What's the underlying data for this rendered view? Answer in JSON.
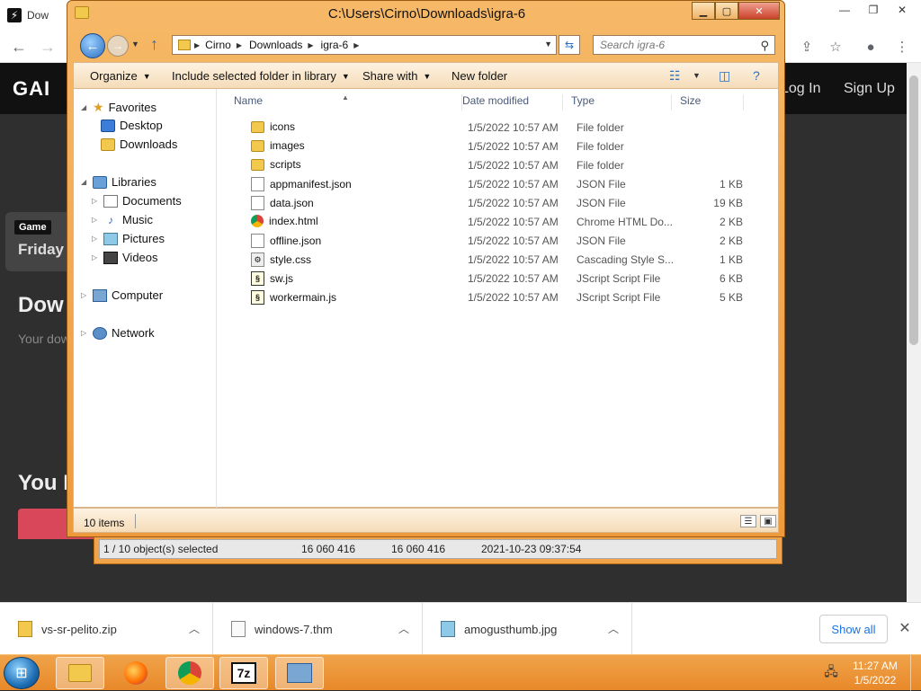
{
  "browser": {
    "tab_title": "Dow",
    "site": {
      "logo": "GAI",
      "login": "Log In",
      "signup": "Sign Up",
      "game_badge": "Game",
      "game_title": "Friday",
      "downloads_heading": "Dow",
      "downloads_sub": "Your dow",
      "you_heading": "You Ma"
    }
  },
  "explorer": {
    "title": "C:\\Users\\Cirno\\Downloads\\igra-6",
    "breadcrumbs": [
      "Cirno",
      "Downloads",
      "igra-6"
    ],
    "search_placeholder": "Search igra-6",
    "commands": {
      "organize": "Organize",
      "include": "Include selected folder in library",
      "share": "Share with",
      "new_folder": "New folder"
    },
    "nav": {
      "favorites": "Favorites",
      "desktop": "Desktop",
      "downloads": "Downloads",
      "libraries": "Libraries",
      "documents": "Documents",
      "music": "Music",
      "pictures": "Pictures",
      "videos": "Videos",
      "computer": "Computer",
      "network": "Network"
    },
    "columns": {
      "name": "Name",
      "date": "Date modified",
      "type": "Type",
      "size": "Size"
    },
    "files": [
      {
        "name": "icons",
        "date": "1/5/2022 10:57 AM",
        "type": "File folder",
        "size": "",
        "icon": "folder-icon"
      },
      {
        "name": "images",
        "date": "1/5/2022 10:57 AM",
        "type": "File folder",
        "size": "",
        "icon": "folder-icon"
      },
      {
        "name": "scripts",
        "date": "1/5/2022 10:57 AM",
        "type": "File folder",
        "size": "",
        "icon": "folder-icon"
      },
      {
        "name": "appmanifest.json",
        "date": "1/5/2022 10:57 AM",
        "type": "JSON File",
        "size": "1 KB",
        "icon": "json-file-icon"
      },
      {
        "name": "data.json",
        "date": "1/5/2022 10:57 AM",
        "type": "JSON File",
        "size": "19 KB",
        "icon": "json-file-icon"
      },
      {
        "name": "index.html",
        "date": "1/5/2022 10:57 AM",
        "type": "Chrome HTML Do...",
        "size": "2 KB",
        "icon": "chrome-icon"
      },
      {
        "name": "offline.json",
        "date": "1/5/2022 10:57 AM",
        "type": "JSON File",
        "size": "2 KB",
        "icon": "json-file-icon"
      },
      {
        "name": "style.css",
        "date": "1/5/2022 10:57 AM",
        "type": "Cascading Style S...",
        "size": "1 KB",
        "icon": "css-file-icon"
      },
      {
        "name": "sw.js",
        "date": "1/5/2022 10:57 AM",
        "type": "JScript Script File",
        "size": "6 KB",
        "icon": "js-file-icon"
      },
      {
        "name": "workermain.js",
        "date": "1/5/2022 10:57 AM",
        "type": "JScript Script File",
        "size": "5 KB",
        "icon": "js-file-icon"
      }
    ],
    "status_count": "10 items"
  },
  "background_window": {
    "selected": "1 / 10 object(s) selected",
    "size1": "16 060 416",
    "size2": "16 060 416",
    "datetime": "2021-10-23 09:37:54"
  },
  "downloads_bar": {
    "items": [
      {
        "name": "vs-sr-pelito.zip"
      },
      {
        "name": "windows-7.thm"
      },
      {
        "name": "amogusthumb.jpg"
      }
    ],
    "show_all": "Show all"
  },
  "taskbar": {
    "time": "11:27 AM",
    "date": "1/5/2022",
    "apps": [
      "explorer",
      "firefox",
      "chrome",
      "7-zip",
      "control-panel"
    ],
    "sevenzip_label": "7z"
  },
  "colors": {
    "window_frame": "#ee9a3c",
    "taskbar": "#e8892a",
    "link_blue": "#1a73e8"
  }
}
